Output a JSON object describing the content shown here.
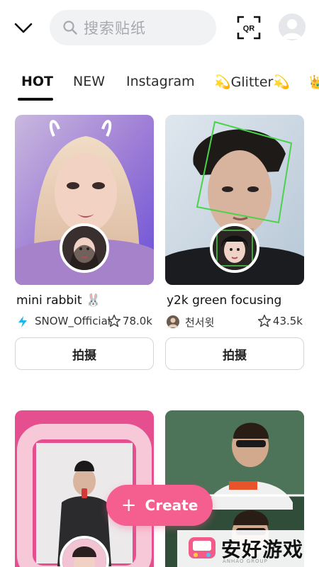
{
  "search": {
    "placeholder": "搜索贴纸"
  },
  "header": {
    "qr_label": "QR"
  },
  "tabs": [
    {
      "label": "HOT"
    },
    {
      "label": "NEW"
    },
    {
      "label": "Instagram"
    },
    {
      "label": "💫Glitter💫"
    },
    {
      "label": "👑"
    }
  ],
  "cards": [
    {
      "title": "mini rabbit 🐰",
      "author": "SNOW_Official",
      "likes": "78.0k",
      "button": "拍摄"
    },
    {
      "title": "y2k green focusing",
      "author": "천서윗",
      "likes": "43.5k",
      "button": "拍摄"
    },
    {
      "title": "",
      "author": "",
      "likes": "",
      "button": ""
    },
    {
      "title": "",
      "author": "",
      "likes": "",
      "button": ""
    }
  ],
  "fab": {
    "label": "Create",
    "plus": "+"
  },
  "watermark": {
    "text": "安好游戏",
    "sub": "ANHAO GROUP"
  },
  "colors": {
    "accent": "#f55f8f",
    "snow_brand": "#1fb6e9"
  }
}
